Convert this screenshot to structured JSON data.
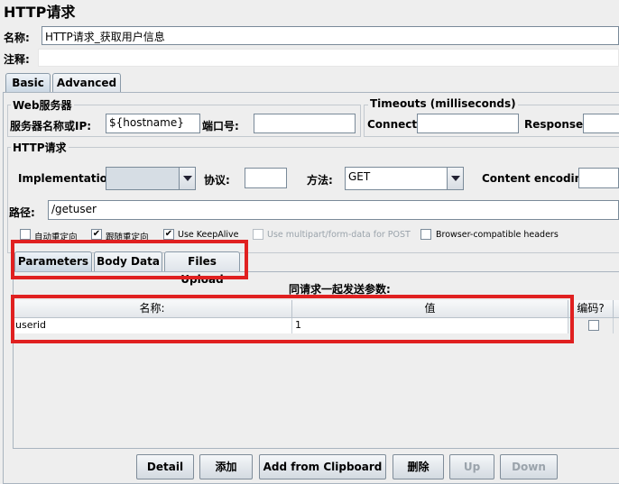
{
  "title": "HTTP请求",
  "name_label": "名称:",
  "name_value": "HTTP请求_获取用户信息",
  "comment_label": "注释:",
  "tabs": [
    "Basic",
    "Advanced"
  ],
  "web_server": {
    "legend": "Web服务器",
    "server_label": "服务器名称或IP:",
    "server_value": "${hostname}",
    "port_label": "端口号:"
  },
  "timeouts": {
    "legend": "Timeouts (milliseconds)",
    "connect_label": "Connect:",
    "response_label": "Response:"
  },
  "http_request": {
    "legend": "HTTP请求",
    "implementation_label": "Implementation:",
    "protocol_label": "协议:",
    "method_label": "方法:",
    "method_value": "GET",
    "encoding_label": "Content encoding:",
    "path_label": "路径:",
    "path_value": "/getuser"
  },
  "options": [
    {
      "label": "自动重定向",
      "checked": false,
      "enabled": true
    },
    {
      "label": "跟随重定向",
      "checked": true,
      "enabled": true
    },
    {
      "label": "Use KeepAlive",
      "checked": true,
      "enabled": true
    },
    {
      "label": "Use multipart/form-data for POST",
      "checked": false,
      "enabled": false
    },
    {
      "label": "Browser-compatible headers",
      "checked": false,
      "enabled": true
    }
  ],
  "sub_tabs": [
    "Parameters",
    "Body Data",
    "Files Upload"
  ],
  "params_title": "同请求一起发送参数:",
  "table": {
    "headers": [
      "名称:",
      "值",
      "编码?"
    ],
    "rows": [
      {
        "name": "userid",
        "value": "1",
        "encode": false
      }
    ]
  },
  "buttons": [
    {
      "label": "Detail",
      "enabled": true
    },
    {
      "label": "添加",
      "enabled": true
    },
    {
      "label": "Add from Clipboard",
      "enabled": true
    },
    {
      "label": "删除",
      "enabled": true
    },
    {
      "label": "Up",
      "enabled": false
    },
    {
      "label": "Down",
      "enabled": false
    }
  ],
  "colors": {
    "highlight": "#e02020",
    "background": "#eeeeee"
  }
}
